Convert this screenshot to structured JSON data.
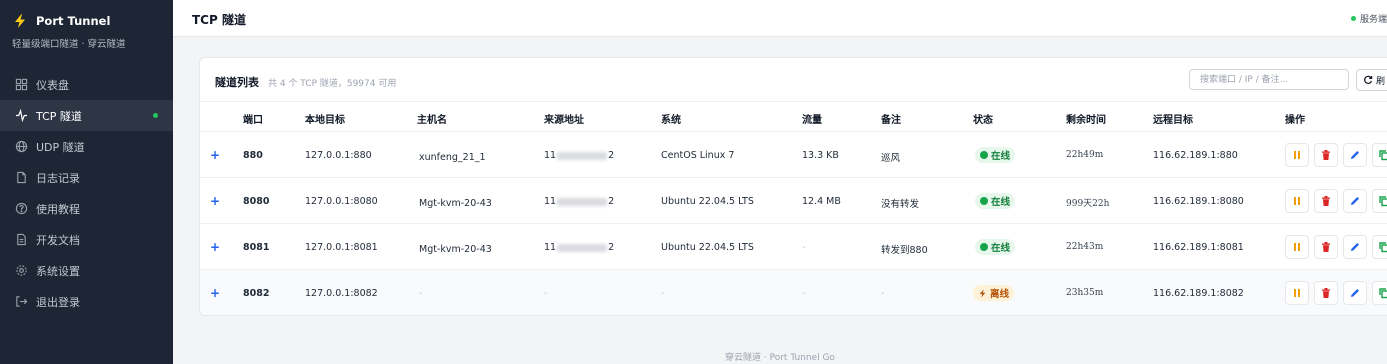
{
  "app": {
    "title": "Port Tunnel",
    "subtitle": "轻量级端口隧道 · 穿云隧道"
  },
  "sidebar": {
    "items": [
      {
        "label": "仪表盘",
        "icon": "dashboard-icon"
      },
      {
        "label": "TCP 隧道",
        "icon": "activity-icon",
        "active": true
      },
      {
        "label": "UDP 隧道",
        "icon": "globe-icon"
      },
      {
        "label": "日志记录",
        "icon": "file-icon"
      },
      {
        "label": "使用教程",
        "icon": "help-icon"
      },
      {
        "label": "开发文档",
        "icon": "doc-icon"
      },
      {
        "label": "系统设置",
        "icon": "gear-icon"
      },
      {
        "label": "退出登录",
        "icon": "logout-icon"
      }
    ]
  },
  "header": {
    "title": "TCP 隧道",
    "server_status": "服务端"
  },
  "card": {
    "title": "隧道列表",
    "summary": "共 4 个 TCP 隧道，59974 可用",
    "search_placeholder": "搜索端口 / IP / 备注...",
    "refresh_label": "刷"
  },
  "table": {
    "columns": [
      "端口",
      "本地目标",
      "主机名",
      "来源地址",
      "系统",
      "流量",
      "备注",
      "状态",
      "剩余时间",
      "远程目标",
      "操作"
    ],
    "rows": [
      {
        "expand": "+",
        "port": "880",
        "local": "127.0.0.1:880",
        "host": "xunfeng_21_1",
        "src_pre": "11",
        "src_post": "2",
        "os": "CentOS Linux 7",
        "traffic": "13.3 KB",
        "note": "巡风",
        "status": "在线",
        "remain": "22h49m",
        "remote": "116.62.189.1:880"
      },
      {
        "expand": "+",
        "port": "8080",
        "local": "127.0.0.1:8080",
        "host": "Mgt-kvm-20-43",
        "src_pre": "11",
        "src_post": "2",
        "os": "Ubuntu 22.04.5 LTS",
        "traffic": "12.4 MB",
        "note": "没有转发",
        "status": "在线",
        "remain": "999天22h",
        "remote": "116.62.189.1:8080"
      },
      {
        "expand": "+",
        "port": "8081",
        "local": "127.0.0.1:8081",
        "host": "Mgt-kvm-20-43",
        "src_pre": "11",
        "src_post": "2",
        "os": "Ubuntu 22.04.5 LTS",
        "traffic": "-",
        "note": "转发到880",
        "status": "在线",
        "remain": "22h43m",
        "remote": "116.62.189.1:8081"
      },
      {
        "expand": "+",
        "port": "8082",
        "local": "127.0.0.1:8082",
        "host": "-",
        "src_pre": "-",
        "src_post": "",
        "os": "-",
        "traffic": "-",
        "note": "-",
        "status": "离线",
        "remain": "23h35m",
        "remote": "116.62.189.1:8082"
      }
    ]
  },
  "footer": "穿云隧道 · Port Tunnel Go",
  "colors": {
    "sidebar_bg": "#1e2534",
    "online": "#16a34a",
    "offline": "#b45309",
    "accent": "#2563eb",
    "danger": "#dc2626",
    "pause": "#f59e0b"
  }
}
